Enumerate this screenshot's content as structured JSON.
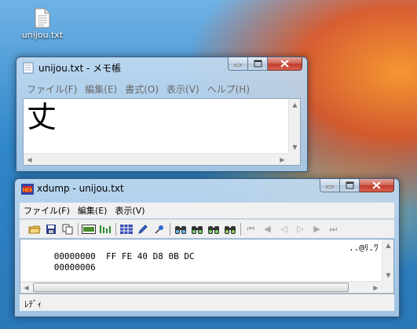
{
  "desktop": {
    "icon_label": "unijou.txt"
  },
  "notepad": {
    "title": "unijou.txt - メモ帳",
    "menu": [
      "ファイル(F)",
      "編集(E)",
      "書式(O)",
      "表示(V)",
      "ヘルプ(H)"
    ],
    "content": "丈"
  },
  "xdump": {
    "title": "xdump - unijou.txt",
    "menu": [
      "ファイル(F)",
      "編集(E)",
      "表示(V)"
    ],
    "lines": [
      {
        "offset": "00000000",
        "hex": "FF FE 40 D8 0B DC",
        "ascii": "..@ﾘ.ﾜ"
      },
      {
        "offset": "00000006",
        "hex": "",
        "ascii": ""
      }
    ],
    "toolbar_icons": [
      "open-folder-icon",
      "save-icon",
      "copy-icon",
      "sep",
      "hex-mode-icon",
      "columns-icon",
      "sep",
      "grid-icon",
      "pencil-icon",
      "pin-icon",
      "sep",
      "find-icon",
      "find-next-icon",
      "find-prev-icon",
      "find-all-icon",
      "sep",
      "first-icon",
      "prev-icon",
      "prev-step-icon",
      "next-step-icon",
      "next-icon",
      "last-icon"
    ],
    "status": "ﾚﾃﾞｨ"
  },
  "colors": {
    "accent": "#3a5f86",
    "close_red": "#c23b2c"
  }
}
